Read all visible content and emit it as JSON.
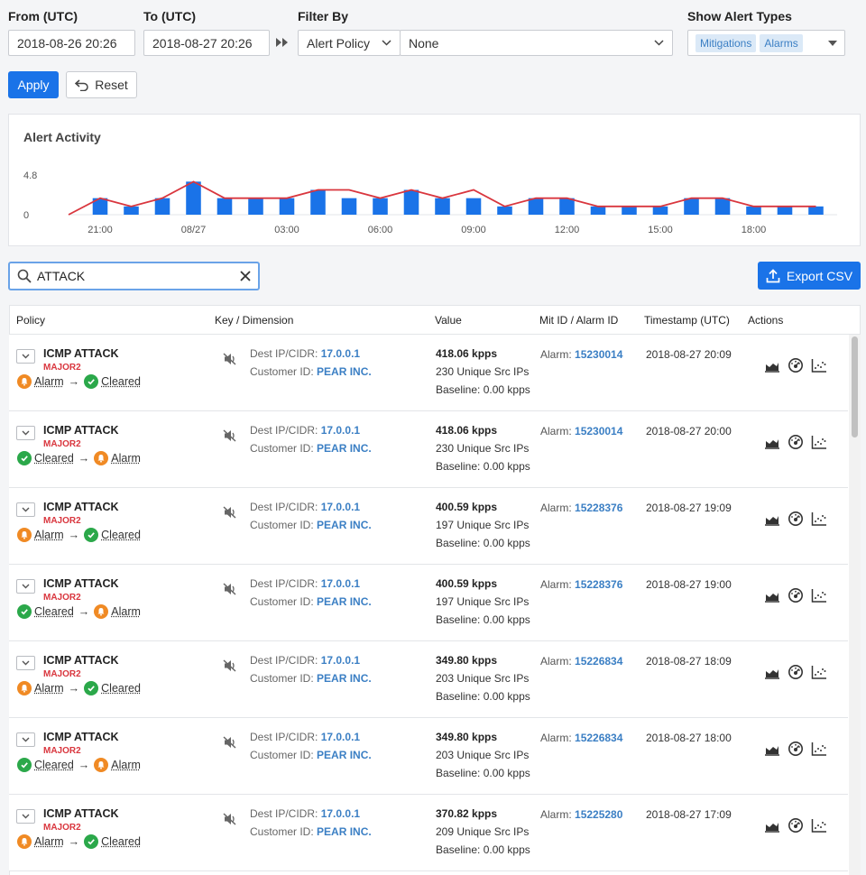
{
  "filters": {
    "from_label": "From (UTC)",
    "from_value": "2018-08-26 20:26",
    "to_label": "To (UTC)",
    "to_value": "2018-08-27 20:26",
    "filter_by_label": "Filter By",
    "filter_by_value": "Alert Policy",
    "filter_value": "None",
    "alert_types_label": "Show Alert Types",
    "alert_types": [
      "Mitigations",
      "Alarms"
    ],
    "apply_label": "Apply",
    "reset_label": "Reset"
  },
  "chart_data": {
    "type": "bar",
    "title": "Alert Activity",
    "yticks": [
      "4.8",
      "0"
    ],
    "ylim": [
      0,
      4.8
    ],
    "xticks": [
      "21:00",
      "08/27",
      "03:00",
      "06:00",
      "09:00",
      "12:00",
      "15:00",
      "18:00"
    ],
    "bar_values": [
      2,
      1,
      2,
      4,
      2,
      2,
      2,
      3,
      2,
      2,
      3,
      2,
      2,
      1,
      2,
      2,
      1,
      1,
      1,
      2,
      2,
      1,
      1,
      1
    ],
    "line_values": [
      0,
      2,
      1,
      2,
      4,
      2,
      2,
      2,
      3,
      3,
      2,
      3,
      2,
      3,
      1,
      2,
      2,
      1,
      1,
      1,
      2,
      2,
      1,
      1,
      1
    ],
    "bar_color": "#1a73e8",
    "line_color": "#d9363e"
  },
  "search": {
    "value": "ATTACK",
    "export_label": "Export CSV"
  },
  "table": {
    "headers": [
      "Policy",
      "Key / Dimension",
      "Value",
      "Mit ID / Alarm ID",
      "Timestamp (UTC)",
      "Actions"
    ],
    "rows": [
      {
        "policy": "ICMP ATTACK",
        "severity": "MAJOR2",
        "from_state": "Alarm",
        "to_state": "Cleared",
        "dest_label": "Dest IP/CIDR:",
        "dest": "17.0.0.1",
        "cust_label": "Customer ID:",
        "cust": "PEAR INC.",
        "value": "418.06 kpps",
        "unique": "230 Unique Src IPs",
        "baseline": "Baseline: 0.00 kpps",
        "alarm_label": "Alarm:",
        "alarm_id": "15230014",
        "timestamp": "2018-08-27 20:09"
      },
      {
        "policy": "ICMP ATTACK",
        "severity": "MAJOR2",
        "from_state": "Cleared",
        "to_state": "Alarm",
        "dest_label": "Dest IP/CIDR:",
        "dest": "17.0.0.1",
        "cust_label": "Customer ID:",
        "cust": "PEAR INC.",
        "value": "418.06 kpps",
        "unique": "230 Unique Src IPs",
        "baseline": "Baseline: 0.00 kpps",
        "alarm_label": "Alarm:",
        "alarm_id": "15230014",
        "timestamp": "2018-08-27 20:00"
      },
      {
        "policy": "ICMP ATTACK",
        "severity": "MAJOR2",
        "from_state": "Alarm",
        "to_state": "Cleared",
        "dest_label": "Dest IP/CIDR:",
        "dest": "17.0.0.1",
        "cust_label": "Customer ID:",
        "cust": "PEAR INC.",
        "value": "400.59 kpps",
        "unique": "197 Unique Src IPs",
        "baseline": "Baseline: 0.00 kpps",
        "alarm_label": "Alarm:",
        "alarm_id": "15228376",
        "timestamp": "2018-08-27 19:09"
      },
      {
        "policy": "ICMP ATTACK",
        "severity": "MAJOR2",
        "from_state": "Cleared",
        "to_state": "Alarm",
        "dest_label": "Dest IP/CIDR:",
        "dest": "17.0.0.1",
        "cust_label": "Customer ID:",
        "cust": "PEAR INC.",
        "value": "400.59 kpps",
        "unique": "197 Unique Src IPs",
        "baseline": "Baseline: 0.00 kpps",
        "alarm_label": "Alarm:",
        "alarm_id": "15228376",
        "timestamp": "2018-08-27 19:00"
      },
      {
        "policy": "ICMP ATTACK",
        "severity": "MAJOR2",
        "from_state": "Alarm",
        "to_state": "Cleared",
        "dest_label": "Dest IP/CIDR:",
        "dest": "17.0.0.1",
        "cust_label": "Customer ID:",
        "cust": "PEAR INC.",
        "value": "349.80 kpps",
        "unique": "203 Unique Src IPs",
        "baseline": "Baseline: 0.00 kpps",
        "alarm_label": "Alarm:",
        "alarm_id": "15226834",
        "timestamp": "2018-08-27 18:09"
      },
      {
        "policy": "ICMP ATTACK",
        "severity": "MAJOR2",
        "from_state": "Cleared",
        "to_state": "Alarm",
        "dest_label": "Dest IP/CIDR:",
        "dest": "17.0.0.1",
        "cust_label": "Customer ID:",
        "cust": "PEAR INC.",
        "value": "349.80 kpps",
        "unique": "203 Unique Src IPs",
        "baseline": "Baseline: 0.00 kpps",
        "alarm_label": "Alarm:",
        "alarm_id": "15226834",
        "timestamp": "2018-08-27 18:00"
      },
      {
        "policy": "ICMP ATTACK",
        "severity": "MAJOR2",
        "from_state": "Alarm",
        "to_state": "Cleared",
        "dest_label": "Dest IP/CIDR:",
        "dest": "17.0.0.1",
        "cust_label": "Customer ID:",
        "cust": "PEAR INC.",
        "value": "370.82 kpps",
        "unique": "209 Unique Src IPs",
        "baseline": "Baseline: 0.00 kpps",
        "alarm_label": "Alarm:",
        "alarm_id": "15225280",
        "timestamp": "2018-08-27 17:09"
      }
    ]
  }
}
